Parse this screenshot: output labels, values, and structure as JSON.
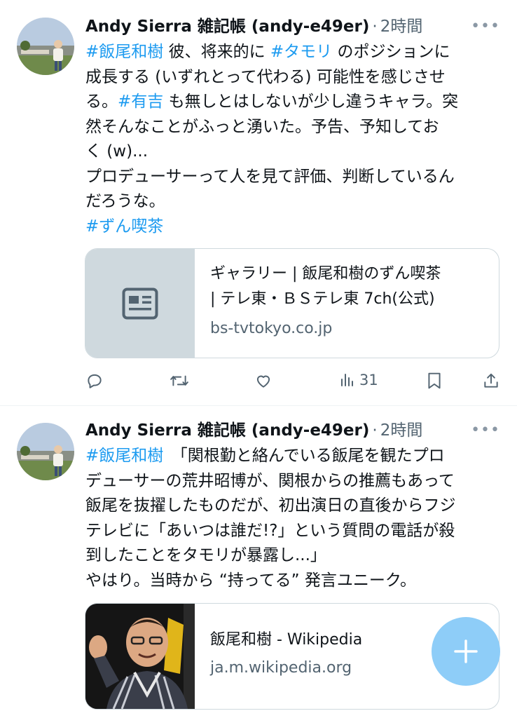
{
  "tweets": [
    {
      "author": "Andy Sierra 雑記帳 (andy-e49er)",
      "time": "2時間",
      "lines": [
        [
          {
            "t": "#飯尾和樹",
            "tag": true
          },
          {
            "t": " 彼、将来的に "
          },
          {
            "t": "#タモリ",
            "tag": true
          },
          {
            "t": " のポジションに"
          }
        ],
        [
          {
            "t": "成長する (いずれとって代わる) 可能性を感じさせ"
          }
        ],
        [
          {
            "t": "る。"
          },
          {
            "t": "#有吉",
            "tag": true
          },
          {
            "t": " も無しとはしないが少し違うキャラ。突"
          }
        ],
        [
          {
            "t": "然そんなことがふっと湧いた。予告、予知してお"
          }
        ],
        [
          {
            "t": "く (w)..."
          }
        ],
        [
          {
            "t": "プロデューサーって人を見て評価、判断しているん"
          }
        ],
        [
          {
            "t": "だろうな。"
          }
        ],
        [
          {
            "t": "#ずん喫茶",
            "tag": true
          }
        ]
      ],
      "card": {
        "title_line1": "ギャラリー | 飯尾和樹のずん喫茶",
        "title_line2": "| テレ東・ＢＳテレ東 7ch(公式)",
        "domain": "bs-tvtokyo.co.jp"
      },
      "views": "31"
    },
    {
      "author": "Andy Sierra 雑記帳 (andy-e49er)",
      "time": "2時間",
      "lines": [
        [
          {
            "t": "#飯尾和樹",
            "tag": true
          },
          {
            "t": "　「関根勤と絡んでいる飯尾を観たプロ"
          }
        ],
        [
          {
            "t": "デューサーの荒井昭博が、関根からの推薦もあって"
          }
        ],
        [
          {
            "t": "飯尾を抜擢したものだが、初出演日の直後からフジ"
          }
        ],
        [
          {
            "t": "テレビに「あいつは誰だ!?」という質問の電話が殺"
          }
        ],
        [
          {
            "t": "到したことをタモリが暴露し...」"
          }
        ],
        [
          {
            "t": "やはり。当時から “持ってる” 発言ユニーク。"
          }
        ]
      ],
      "card": {
        "title_line1": "飯尾和樹 - Wikipedia",
        "domain": "ja.m.wikipedia.org"
      }
    }
  ],
  "icons": {
    "reply": "reply-icon",
    "retweet": "retweet-icon",
    "like": "heart-icon",
    "views": "analytics-icon",
    "bookmark": "bookmark-icon",
    "share": "share-icon",
    "compose": "plus-icon"
  },
  "colors": {
    "hashtag": "#1d9bf0",
    "secondary": "#536471",
    "fab": "#8ecdf8"
  }
}
